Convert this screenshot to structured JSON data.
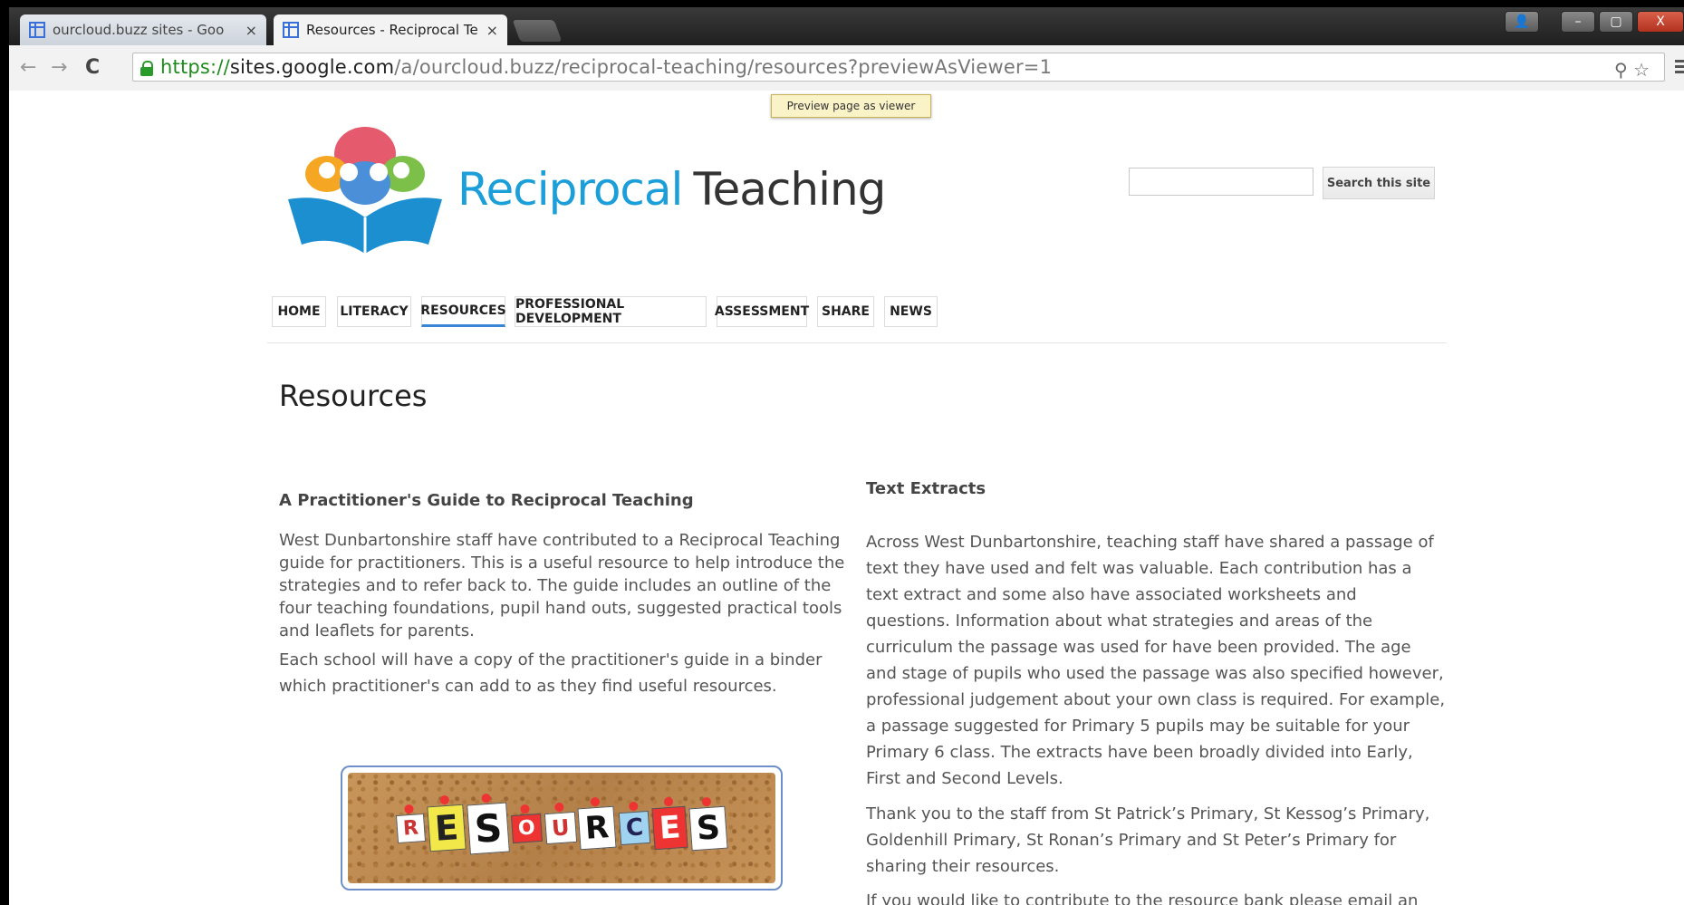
{
  "browser": {
    "tabs": [
      {
        "title": "ourcloud.buzz sites - Goo",
        "close": "×",
        "active": false
      },
      {
        "title": "Resources - Reciprocal Te",
        "close": "×",
        "active": true
      }
    ],
    "window_buttons": {
      "minimize": "–",
      "maximize": "▢",
      "close": "X",
      "user": "👤"
    },
    "nav": {
      "back": "←",
      "forward": "→",
      "reload": "C"
    },
    "url": {
      "scheme": "https://",
      "host": "sites.google.com",
      "path": "/a/ourcloud.buzz/reciprocal-teaching/resources?previewAsViewer=1"
    },
    "omni_icons": {
      "zoom": "⚲",
      "star": "☆"
    }
  },
  "tooltip": "Preview page as viewer",
  "site": {
    "logo_word1": "Reciprocal",
    "logo_word2": "Teaching",
    "search_button": "Search this site",
    "search_value": ""
  },
  "nav": {
    "items": [
      {
        "label": "HOME",
        "selected": false
      },
      {
        "label": "LITERACY",
        "selected": false
      },
      {
        "label": "RESOURCES",
        "selected": true
      },
      {
        "label": "PROFESSIONAL DEVELOPMENT",
        "selected": false
      },
      {
        "label": "ASSESSMENT",
        "selected": false
      },
      {
        "label": "SHARE",
        "selected": false
      },
      {
        "label": "NEWS",
        "selected": false
      }
    ]
  },
  "page": {
    "title": "Resources",
    "left": {
      "heading": "A Practitioner's Guide to Reciprocal Teaching",
      "p1": "West Dunbartonshire staff have contributed to a Reciprocal Teaching guide for practitioners. This is a useful resource to help introduce the strategies and to refer back to. The guide includes an outline of the four teaching foundations, pupil hand outs, suggested practical tools and leaflets for parents.",
      "p2": "Each school will have a copy of the practitioner's guide in a binder which practitioner's can add to as they find useful resources.",
      "image_letters": [
        "R",
        "E",
        "S",
        "O",
        "U",
        "R",
        "C",
        "E",
        "S"
      ]
    },
    "right": {
      "heading": "Text Extracts",
      "p1": "Across West Dunbartonshire, teaching staff have shared a passage of text they have used and felt was valuable. Each contribution has a text extract and some also have associated worksheets and questions. Information about what strategies and areas of the curriculum the passage was used for have been provided. The age and stage of pupils who used the passage was also specified however, professional judgement about your own class is required. For example, a passage suggested for Primary 5 pupils may be suitable for your Primary 6 class. The extracts have been broadly divided into Early, First and Second Levels.",
      "p2": "Thank you to the staff from St Patrick’s Primary, St Kessog’s Primary, Goldenhill Primary, St Ronan’s Primary and St Peter’s Primary for sharing their resources.",
      "p3": "If you would like to contribute to the resource bank please email an"
    }
  },
  "colors": {
    "accent": "#3a86d6",
    "logo_blue": "#1c9fd8",
    "url_green": "#1e8a1e"
  }
}
